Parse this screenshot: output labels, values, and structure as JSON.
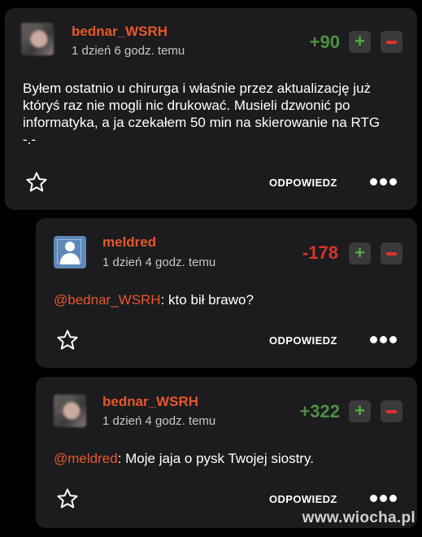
{
  "comments": [
    {
      "username": "bednar_WSRH",
      "timestamp": "1 dzień 6 godz. temu",
      "score": "+90",
      "text": "Byłem ostatnio u chirurga i właśnie przez aktualizację już któryś raz nie mogli nic drukować. Musieli dzwonić po informatyka, a ja czekałem 50 min na skierowanie na RTG -.-",
      "reply_label": "ODPOWIEDZ"
    },
    {
      "username": "meldred",
      "timestamp": "1 dzień 4 godz. temu",
      "score": "-178",
      "mention": "@bednar_WSRH",
      "text": ": kto bił brawo?",
      "reply_label": "ODPOWIEDZ"
    },
    {
      "username": "bednar_WSRH",
      "timestamp": "1 dzień 4 godz. temu",
      "score": "+322",
      "mention": "@meldred",
      "text": ": Moje jaja o pysk Twojej siostry.",
      "reply_label": "ODPOWIEDZ"
    }
  ],
  "vote": {
    "plus": "+"
  },
  "watermark": "www.wiocha.pl",
  "colors": {
    "accent": "#e8572a",
    "positive": "#4e8f44",
    "negative": "#d9322c",
    "card": "#1c1c1e"
  }
}
